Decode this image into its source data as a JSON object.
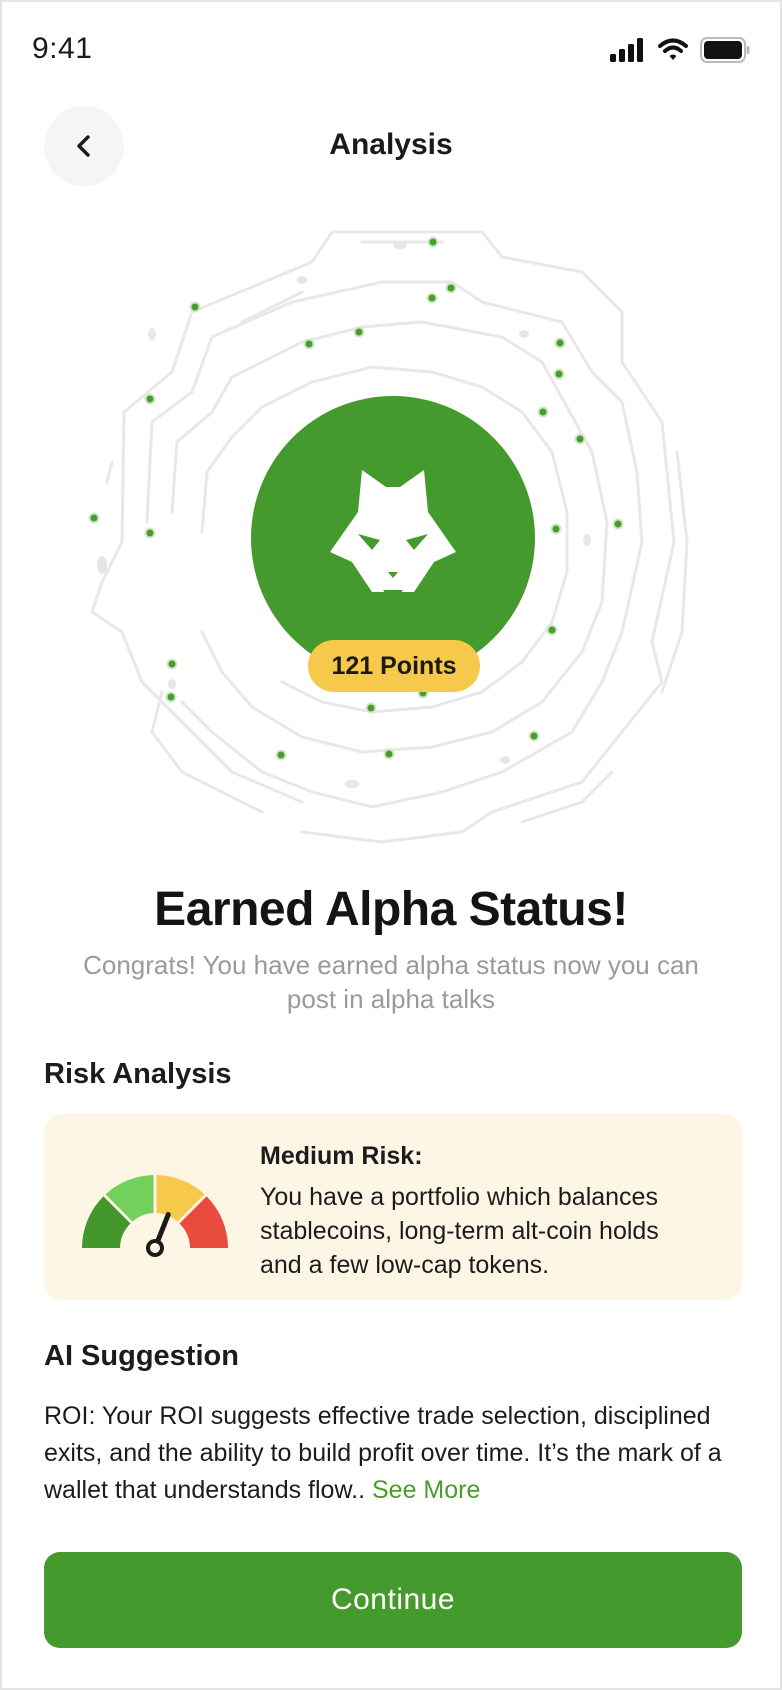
{
  "status_bar": {
    "time": "9:41"
  },
  "header": {
    "title": "Analysis"
  },
  "hero": {
    "points_label": "121 Points"
  },
  "status": {
    "headline": "Earned Alpha Status!",
    "subtext": "Congrats! You have earned alpha status now you can post in alpha talks"
  },
  "risk": {
    "section_title": "Risk Analysis",
    "level": "Medium Risk:",
    "description": "You have a portfolio which balances stablecoins, long-term alt-coin holds and a few low-cap tokens.",
    "gauge_level": 0.62,
    "gauge_colors": [
      "#43972c",
      "#72d15b",
      "#f6c94b",
      "#e94b3c"
    ]
  },
  "ai": {
    "section_title": "AI Suggestion",
    "text": "ROI: Your ROI suggests effective trade selection, disciplined exits, and the ability to build profit over time. It’s the mark of a wallet that understands flow..",
    "see_more": "See More"
  },
  "actions": {
    "continue_label": "Continue"
  },
  "colors": {
    "brand_green": "#459a2d",
    "badge_yellow": "#f6c94b",
    "card_bg": "#fdf6e4"
  }
}
